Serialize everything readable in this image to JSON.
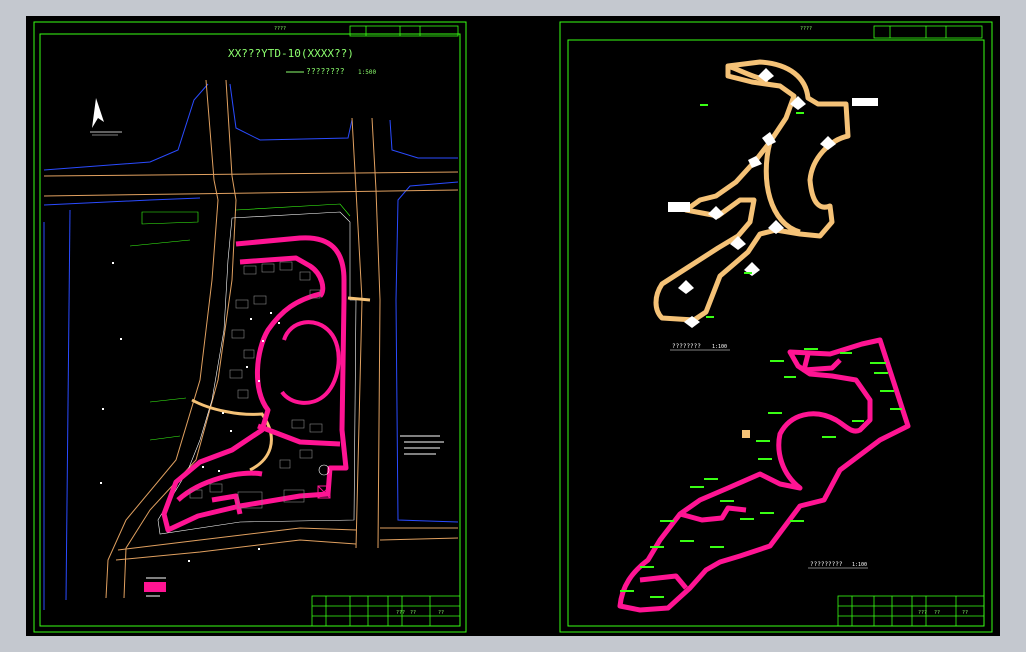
{
  "window": {
    "background": "#c4c8cf",
    "canvas_color": "#000000"
  },
  "sheet_left": {
    "header_code": "????",
    "title": "XX???YTD-10(XXXX??)",
    "subtitle": "????????",
    "scale": "1:500",
    "tb_row1": "???",
    "tb_row2": "??",
    "tb_row3": "??"
  },
  "sheet_right": {
    "header_code": "????",
    "upper_label": "????????",
    "upper_scale": "1:100",
    "lower_label": "?????????",
    "lower_scale": "1:100",
    "tb_row1": "???",
    "tb_row2": "??",
    "tb_row3": "??"
  },
  "colors": {
    "border": "#39ff14",
    "magenta": "#ff1493",
    "path": "#f5c277",
    "road": "#e0a060",
    "blue": "#2a4bff",
    "green": "#39ff14",
    "text_green": "#8cff6e"
  }
}
